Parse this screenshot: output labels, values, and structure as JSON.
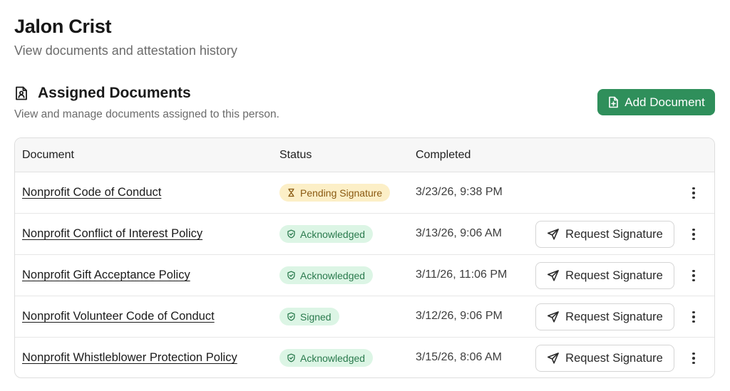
{
  "page": {
    "title": "Jalon Crist",
    "subtitle": "View documents and attestation history"
  },
  "section": {
    "title": "Assigned Documents",
    "subtitle": "View and manage documents assigned to this person.",
    "icon": "document-person-icon",
    "add_button_label": "Add Document"
  },
  "table": {
    "headers": {
      "document": "Document",
      "status": "Status",
      "completed": "Completed"
    },
    "rows": [
      {
        "document": "Nonprofit Code of Conduct",
        "status": "Pending Signature",
        "status_type": "pending",
        "completed": "3/23/26, 9:38 PM",
        "action": ""
      },
      {
        "document": "Nonprofit Conflict of Interest Policy",
        "status": "Acknowledged",
        "status_type": "ack",
        "completed": "3/13/26, 9:06 AM",
        "action": "Request Signature"
      },
      {
        "document": "Nonprofit Gift Acceptance Policy",
        "status": "Acknowledged",
        "status_type": "ack",
        "completed": "3/11/26, 11:06 PM",
        "action": "Request Signature"
      },
      {
        "document": "Nonprofit Volunteer Code of Conduct",
        "status": "Signed",
        "status_type": "ack",
        "completed": "3/12/26, 9:06 PM",
        "action": "Request Signature"
      },
      {
        "document": "Nonprofit Whistleblower Protection Policy",
        "status": "Acknowledged",
        "status_type": "ack",
        "completed": "3/15/26, 8:06 AM",
        "action": "Request Signature"
      }
    ]
  },
  "colors": {
    "primary_button": "#2f8f5b",
    "pending_bg": "#fcefc7",
    "pending_text": "#8a5a12",
    "ack_bg": "#dcf5e5",
    "ack_text": "#2a7a4d"
  }
}
